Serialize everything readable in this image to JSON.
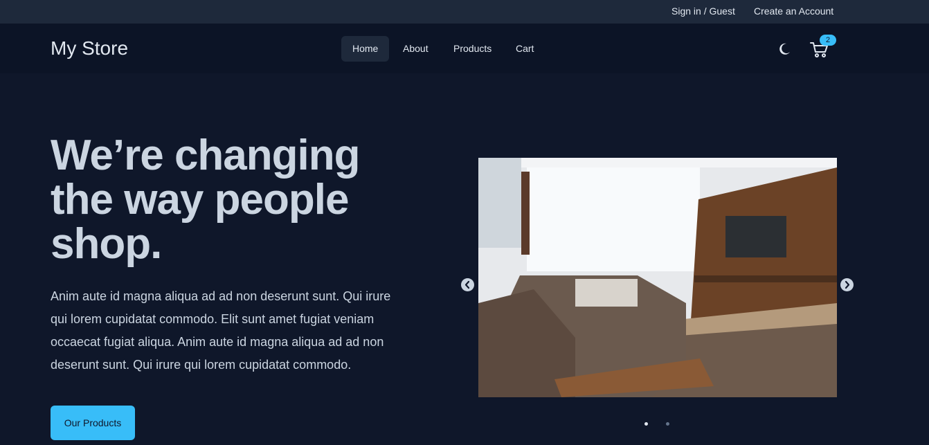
{
  "topbar": {
    "signin": "Sign in / Guest",
    "create": "Create an Account"
  },
  "brand": "My Store",
  "nav": {
    "home": "Home",
    "about": "About",
    "products": "Products",
    "cart": "Cart",
    "active": "Home"
  },
  "cart_count": "2",
  "icons": {
    "theme": "moon-icon",
    "cart": "shopping-cart-icon",
    "prev": "chevron-left-icon",
    "next": "chevron-right-icon"
  },
  "hero": {
    "title": "We’re changing the way people shop.",
    "description": "Anim aute id magna aliqua ad ad non deserunt sunt. Qui irure qui lorem cupidatat commodo. Elit sunt amet fugiat veniam occaecat fugiat aliqua. Anim aute id magna aliqua ad ad non deserunt sunt. Qui irure qui lorem cupidatat commodo.",
    "cta": "Our Products"
  },
  "carousel": {
    "active_index": 1,
    "slide_count": 2
  },
  "colors": {
    "background": "#0f172a",
    "topbar": "#1e293b",
    "navbar": "#0c1426",
    "accent": "#38bdf8",
    "text": "#cbd5e1"
  }
}
